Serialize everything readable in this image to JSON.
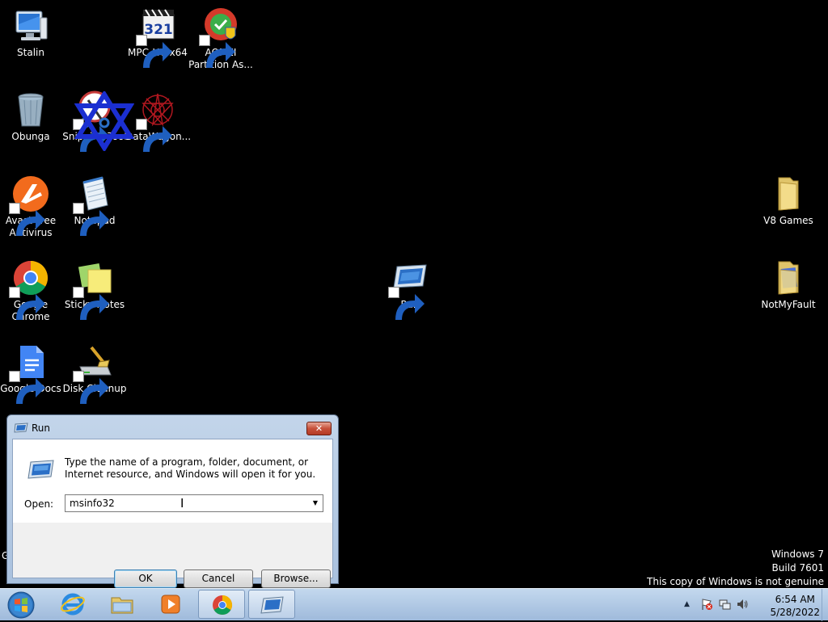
{
  "desktop": {
    "icons": [
      {
        "label": "Stalin"
      },
      {
        "label": "MPC-HC x64"
      },
      {
        "label": "AOMEI Partition As..."
      },
      {
        "label": "Obunga"
      },
      {
        "label": "Snipping Tool"
      },
      {
        "label": "DataWagon..."
      },
      {
        "label": "Avast Free Antivirus"
      },
      {
        "label": "Notepad"
      },
      {
        "label": "Google Chrome"
      },
      {
        "label": "Sticky Notes"
      },
      {
        "label": "Google Docs"
      },
      {
        "label": "Disk Cleanup"
      },
      {
        "label": "Run"
      },
      {
        "label": "V8 Games"
      },
      {
        "label": "NotMyFault"
      }
    ]
  },
  "run_dialog": {
    "title": "Run",
    "close_glyph": "✕",
    "description": "Type the name of a program, folder, document, or Internet resource, and Windows will open it for you.",
    "open_label": "Open:",
    "open_value": "msinfo32",
    "ok_label": "OK",
    "cancel_label": "Cancel",
    "browse_label": "Browse..."
  },
  "watermark": {
    "line1": "Windows 7",
    "line2": "Build 7601",
    "line3": "This copy of Windows is not genuine",
    "stray": "G"
  },
  "taskbar": {
    "pinned": [
      "Internet Explorer",
      "Windows Explorer",
      "Windows Media Player",
      "Google Chrome",
      "Run"
    ],
    "clock_time": "6:54 AM",
    "clock_date": "5/28/2022",
    "tray_expand_glyph": "▲"
  },
  "colors": {
    "desktop_bg": "#000000",
    "taskbar": "#b3cbe6",
    "dialog_frame": "#b8cde6",
    "star": "#1b2fd1"
  }
}
